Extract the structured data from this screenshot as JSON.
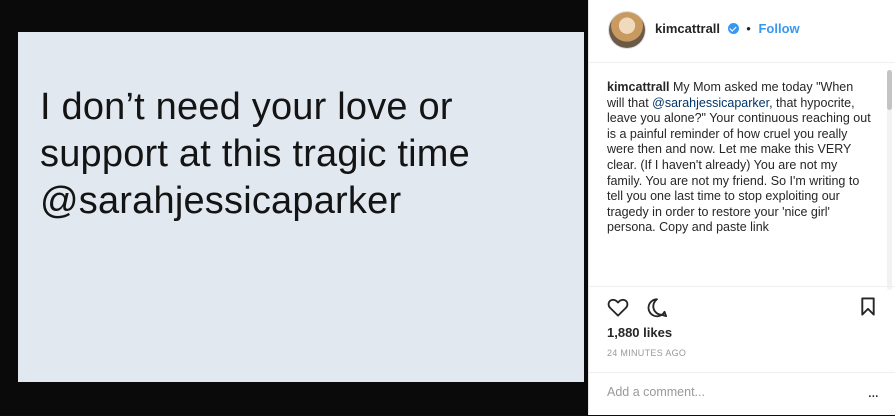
{
  "post": {
    "image_text": "I don’t need your love or support at this tragic time @sarahjessicaparker"
  },
  "header": {
    "username": "kimcattrall",
    "separator": "•",
    "follow_label": "Follow"
  },
  "caption": {
    "username": "kimcattrall",
    "text_before": " My Mom asked me today \"When will that ",
    "mention": "@sarahjessicaparker",
    "text_after": ", that hypocrite, leave you alone?\" Your continuous reaching out is a painful reminder of how cruel you really were then and now. Let me make this VERY clear. (If I haven't already) You are not my family. You are not my friend. So I'm writing to tell you one last time to stop exploiting our tragedy in order to restore your 'nice girl' persona. Copy and paste link"
  },
  "engagement": {
    "likes": "1,880 likes",
    "timestamp": "24 MINUTES AGO"
  },
  "comment": {
    "placeholder": "Add a comment...",
    "more": "..."
  },
  "icons": {
    "heart": "heart-icon",
    "comment": "comment-icon",
    "bookmark": "bookmark-icon",
    "verified": "verified-badge-icon",
    "more": "more-options-icon"
  },
  "colors": {
    "follow": "#3897f0",
    "image_background": "#e1e8ef",
    "quote_text": "#141414"
  }
}
